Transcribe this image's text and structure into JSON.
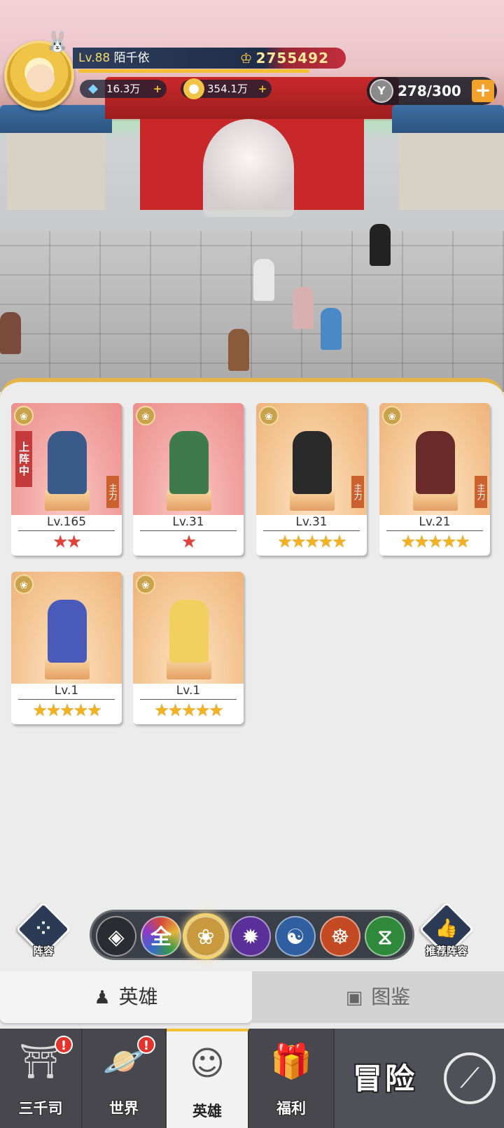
{
  "player": {
    "level": "Lv.88",
    "name": "陌千依",
    "power": "2755492",
    "diamonds": "16.3万",
    "gold": "354.1万",
    "stamina": "278/300"
  },
  "heroes": [
    {
      "level": "Lv.165",
      "stars": "★★",
      "star_color": "red",
      "frame": "red",
      "deployed_tag": "上阵中",
      "main_tag": "主力"
    },
    {
      "level": "Lv.31",
      "stars": "★",
      "star_color": "red",
      "frame": "red",
      "deployed_tag": "",
      "main_tag": ""
    },
    {
      "level": "Lv.31",
      "stars": "★★★★★",
      "star_color": "gold",
      "frame": "gold",
      "deployed_tag": "",
      "main_tag": "主力"
    },
    {
      "level": "Lv.21",
      "stars": "★★★★★",
      "star_color": "gold",
      "frame": "gold",
      "deployed_tag": "",
      "main_tag": "主力"
    },
    {
      "level": "Lv.1",
      "stars": "★★★★★",
      "star_color": "gold",
      "frame": "gold",
      "deployed_tag": "",
      "main_tag": ""
    },
    {
      "level": "Lv.1",
      "stars": "★★★★★",
      "star_color": "gold",
      "frame": "gold",
      "deployed_tag": "",
      "main_tag": ""
    }
  ],
  "side_buttons": {
    "lineup": "阵容",
    "recommend": "推荐阵容"
  },
  "filters": [
    {
      "icon": "diamond-grid-icon",
      "label": "",
      "color": "#2a2c31"
    },
    {
      "icon": "all-icon",
      "label": "全",
      "color": "#7a6a3c"
    },
    {
      "icon": "lotus-icon",
      "label": "",
      "color": "#c89a3d"
    },
    {
      "icon": "flame-icon",
      "label": "",
      "color": "#5b2f9a"
    },
    {
      "icon": "taiji-icon",
      "label": "",
      "color": "#2f5fa0"
    },
    {
      "icon": "meditation-icon",
      "label": "",
      "color": "#c34a22"
    },
    {
      "icon": "dna-icon",
      "label": "",
      "color": "#2e8a3a"
    }
  ],
  "tabs": {
    "heroes": "英雄",
    "codex": "图鉴"
  },
  "nav": {
    "sanqiansi": "三千司",
    "world": "世界",
    "heroes": "英雄",
    "welfare": "福利",
    "adventure": "冒险",
    "badge": "!"
  },
  "colors": {
    "accent_gold": "#f2c133",
    "nav_bg": "#47474d",
    "badge_red": "#e4322c"
  }
}
